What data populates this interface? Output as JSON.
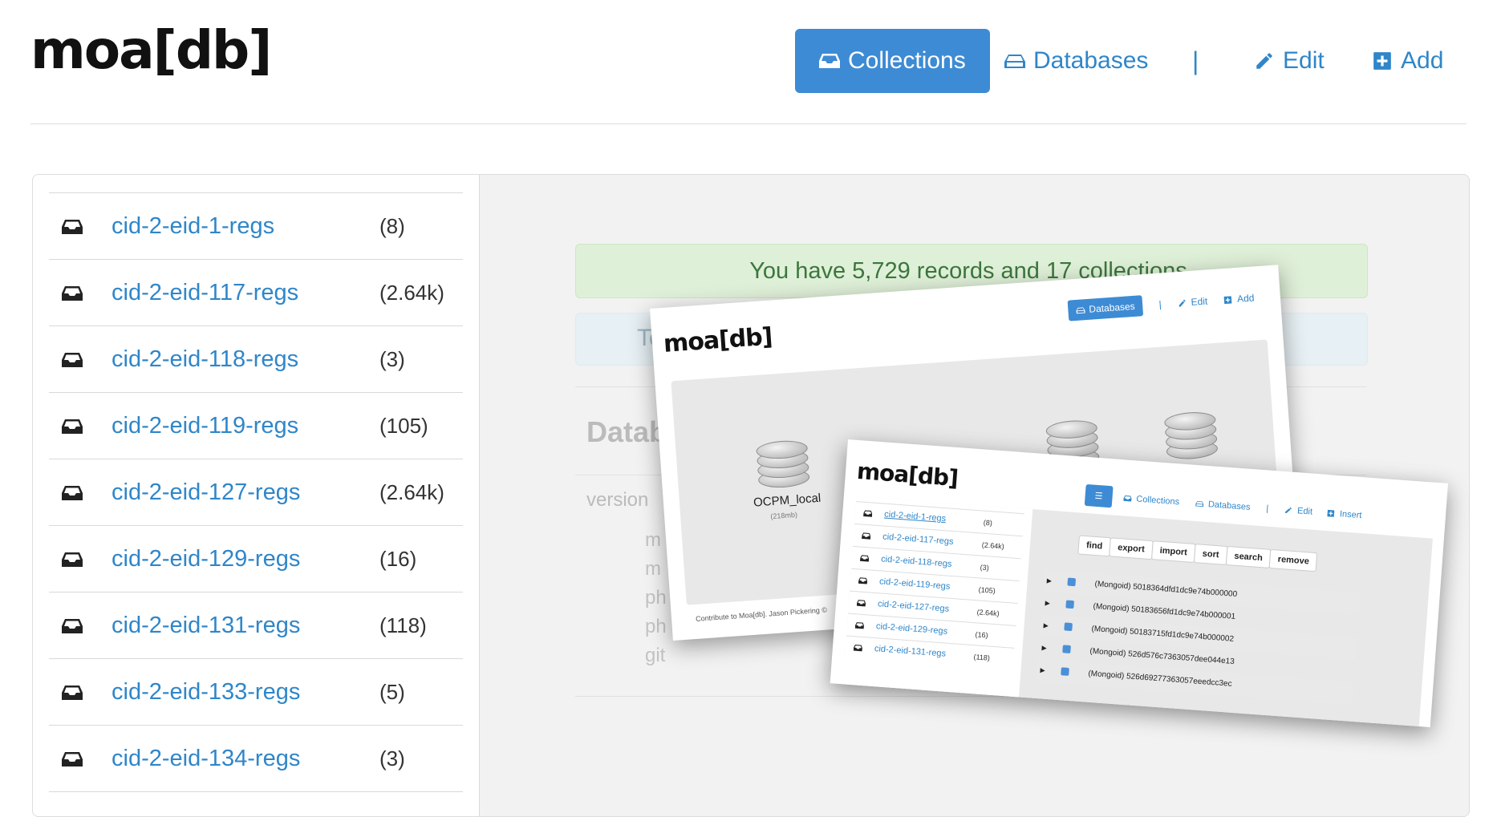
{
  "header": {
    "logo": "moa[db]",
    "nav": [
      {
        "label": "Collections",
        "icon": "inbox-icon",
        "active": true
      },
      {
        "label": "Databases",
        "icon": "hdd-icon",
        "active": false
      },
      {
        "label": "|",
        "icon": null,
        "active": false
      },
      {
        "label": "Edit",
        "icon": "pencil-icon",
        "active": false
      },
      {
        "label": "Add",
        "icon": "plus-square-icon",
        "active": false
      }
    ]
  },
  "sidebar": {
    "collections": [
      {
        "name": "cid-2-eid-1-regs",
        "count": "(8)"
      },
      {
        "name": "cid-2-eid-117-regs",
        "count": "(2.64k)"
      },
      {
        "name": "cid-2-eid-118-regs",
        "count": "(3)"
      },
      {
        "name": "cid-2-eid-119-regs",
        "count": "(105)"
      },
      {
        "name": "cid-2-eid-127-regs",
        "count": "(2.64k)"
      },
      {
        "name": "cid-2-eid-129-regs",
        "count": "(16)"
      },
      {
        "name": "cid-2-eid-131-regs",
        "count": "(118)"
      },
      {
        "name": "cid-2-eid-133-regs",
        "count": "(5)"
      },
      {
        "name": "cid-2-eid-134-regs",
        "count": "(3)"
      }
    ]
  },
  "main": {
    "alert_success": "You have 5,729 records and 17 collections.",
    "alert_info_partial": "To",
    "section_title_partial": "Datab",
    "version_label": "version",
    "fragments": [
      "m",
      "m",
      "ph",
      "ph",
      "git"
    ]
  },
  "shot1": {
    "logo": "moa[db]",
    "nav": {
      "databases": "Databases",
      "sep": "|",
      "edit": "Edit",
      "add": "Add"
    },
    "db_name": "OCPM_local",
    "db_size": "(218mb)",
    "footer": "Contribute to Moa[db]. Jason Pickering ©"
  },
  "shot2": {
    "logo": "moa[db]",
    "nav": {
      "collections": "Collections",
      "databases": "Databases",
      "sep": "|",
      "edit": "Edit",
      "insert": "Insert"
    },
    "collections": [
      {
        "name": "cid-2-eid-1-regs",
        "count": "(8)"
      },
      {
        "name": "cid-2-eid-117-regs",
        "count": "(2.64k)"
      },
      {
        "name": "cid-2-eid-118-regs",
        "count": "(3)"
      },
      {
        "name": "cid-2-eid-119-regs",
        "count": "(105)"
      },
      {
        "name": "cid-2-eid-127-regs",
        "count": "(2.64k)"
      },
      {
        "name": "cid-2-eid-129-regs",
        "count": "(16)"
      },
      {
        "name": "cid-2-eid-131-regs",
        "count": "(118)"
      }
    ],
    "query_buttons": [
      "find",
      "export",
      "import",
      "sort",
      "search",
      "remove"
    ],
    "documents": [
      "(Mongoid) 5018364dfd1dc9e74b000000",
      "(Mongoid) 50183656fd1dc9e74b000001",
      "(Mongoid) 50183715fd1dc9e74b000002",
      "(Mongoid) 526d576c7363057dee044e13",
      "(Mongoid) 526d69277363057eeedcc3ec"
    ]
  },
  "colors": {
    "accent": "#3d8bd4",
    "link": "#2f86c9",
    "success_bg": "#dff0d8",
    "success_text": "#3c763d"
  }
}
